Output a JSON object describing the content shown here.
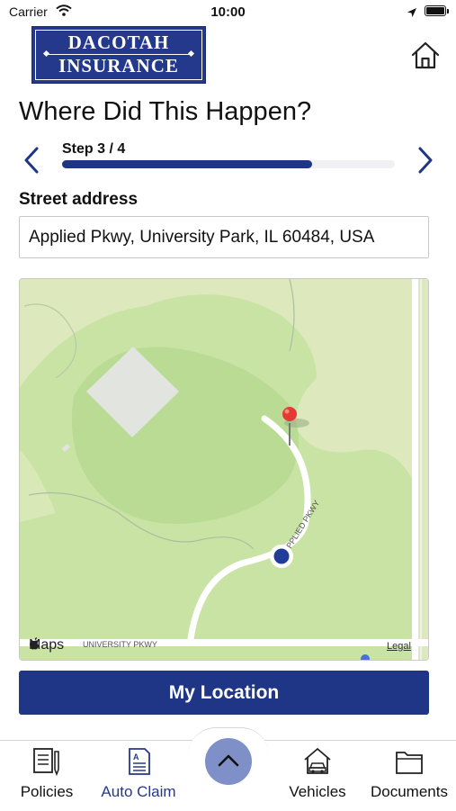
{
  "status_bar": {
    "carrier": "Carrier",
    "time": "10:00"
  },
  "header": {
    "logo_line1": "Dacotah",
    "logo_line2": "Insurance"
  },
  "page": {
    "title": "Where Did This Happen?"
  },
  "stepper": {
    "label": "Step 3 / 4",
    "progress": 0.75
  },
  "address": {
    "label": "Street address",
    "value": "Applied Pkwy, University Park, IL 60484, USA"
  },
  "map": {
    "attribution": "Maps",
    "legal": "Legal",
    "road_labels": [
      "APPLIED PKWY",
      "UNIVERSITY PKWY"
    ],
    "pin_color": "#e53935",
    "location_dot_color": "#1f3d99"
  },
  "actions": {
    "my_location": "My Location"
  },
  "tabbar": {
    "items": [
      {
        "label": "Policies",
        "icon": "policies-icon",
        "active": false
      },
      {
        "label": "Auto Claim",
        "icon": "auto-claim-icon",
        "active": true
      },
      {
        "label": "Vehicles",
        "icon": "vehicles-icon",
        "active": false
      },
      {
        "label": "Documents",
        "icon": "documents-icon",
        "active": false
      }
    ],
    "center_button_icon": "chevron-up-icon"
  },
  "colors": {
    "brand": "#1f3585",
    "active_tab": "#24398c",
    "fab": "#7f8fc8"
  }
}
